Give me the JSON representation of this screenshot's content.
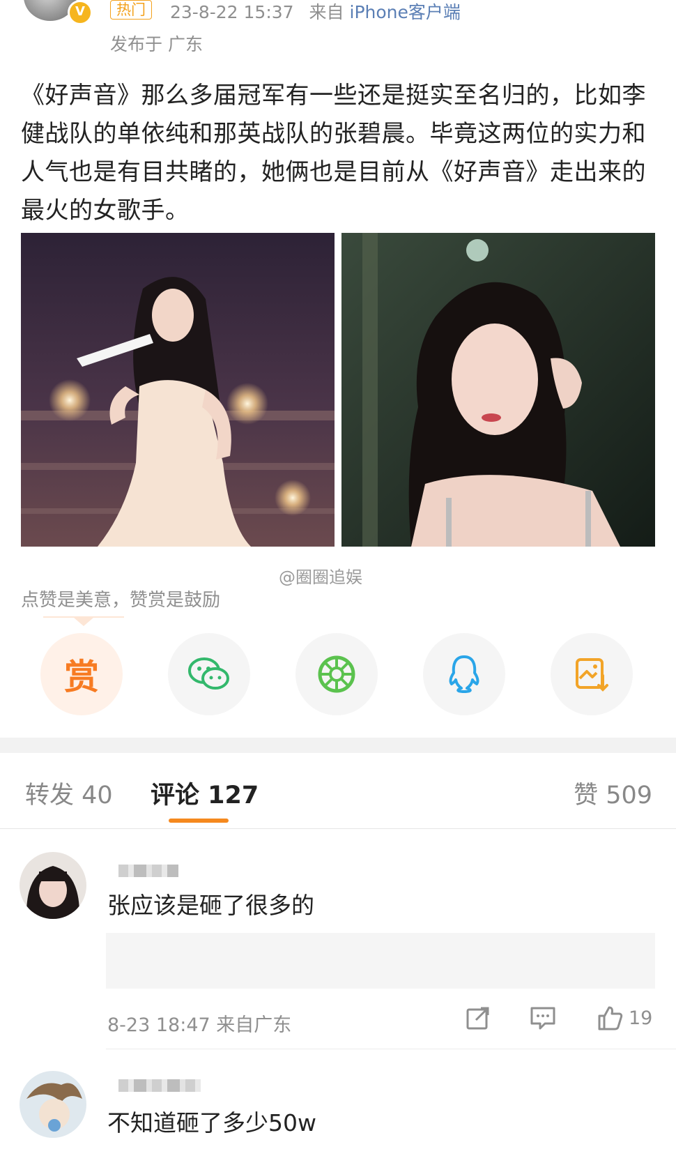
{
  "post": {
    "badge": "V",
    "hot_tag": "热门",
    "time": "23-8-22 15:37",
    "source_prefix": "来自",
    "source": "iPhone客户端",
    "location": "发布于 广东",
    "text": "《好声音》那么多届冠军有一些还是挺实至名归的，比如李健战队的单依纯和那英战队的张碧晨。毕竟这两位的实力和人气也是有目共睹的，她俩也是目前从《好声音》走出来的最火的女歌手。",
    "watermark": "@圈圈追娱",
    "reward_tip": "点赞是美意，赞赏是鼓励"
  },
  "share": {
    "reward_label": "赏",
    "reward_color": "#f77b22",
    "wechat_color": "#33b86c",
    "moments_color": "#5bc24e",
    "qq_color": "#2aa5e8",
    "save_color": "#f2a428"
  },
  "tabs": {
    "repost": "转发 40",
    "comments": "评论 127",
    "likes": "赞 509",
    "accent_color": "#f5891f"
  },
  "comments": [
    {
      "text": "张应该是砸了很多的",
      "meta": "8-23 18:47 来自广东",
      "likes": "19"
    },
    {
      "text": "不知道砸了多少50w"
    }
  ]
}
